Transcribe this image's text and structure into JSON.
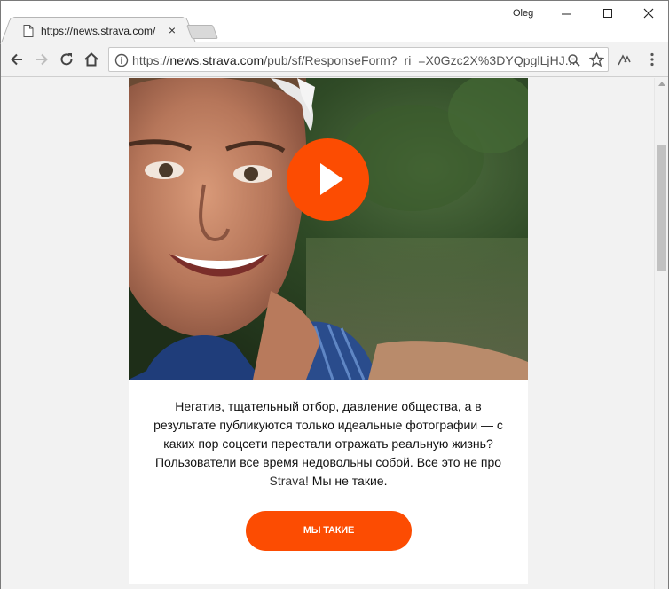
{
  "browser": {
    "tab": {
      "title": "https://news.strava.com/",
      "close_glyph": "×",
      "icon": "document-icon"
    },
    "user_name": "Oleg",
    "window_controls": [
      "minimize-icon",
      "maximize-icon",
      "close-icon"
    ],
    "nav": {
      "back_icon": "back-arrow-icon",
      "forward_icon": "forward-arrow-icon",
      "reload_icon": "reload-icon",
      "home_icon": "home-icon"
    },
    "address": {
      "protocol": "https://",
      "host": "news.strava.com",
      "path": "/pub/sf/ResponseForm?_ri_=X0Gzc2X%3DYQpglLjHJ...",
      "info_icon": "info-icon",
      "zoom_icon": "zoom-icon",
      "bookmark_icon": "star-icon"
    },
    "extension_icon": "strava-extension-icon",
    "menu_icon": "kebab-menu-icon"
  },
  "page": {
    "hero": {
      "description_icon": "play-icon"
    },
    "body": {
      "text_before_link": "Негатив, тщательный отбор, давление общества, а в результате публикуются только идеальные фотографии — с каких пор соцсети перестали отражать реальную жизнь? Пользователи все время недовольны собой. Все это не про ",
      "link_text": "Strava!",
      "text_after_link": " Мы не такие."
    },
    "cta_label": "МЫ ТАКИЕ"
  },
  "colors": {
    "brand_orange": "#fc4c02",
    "page_bg": "#f2f2f2"
  }
}
